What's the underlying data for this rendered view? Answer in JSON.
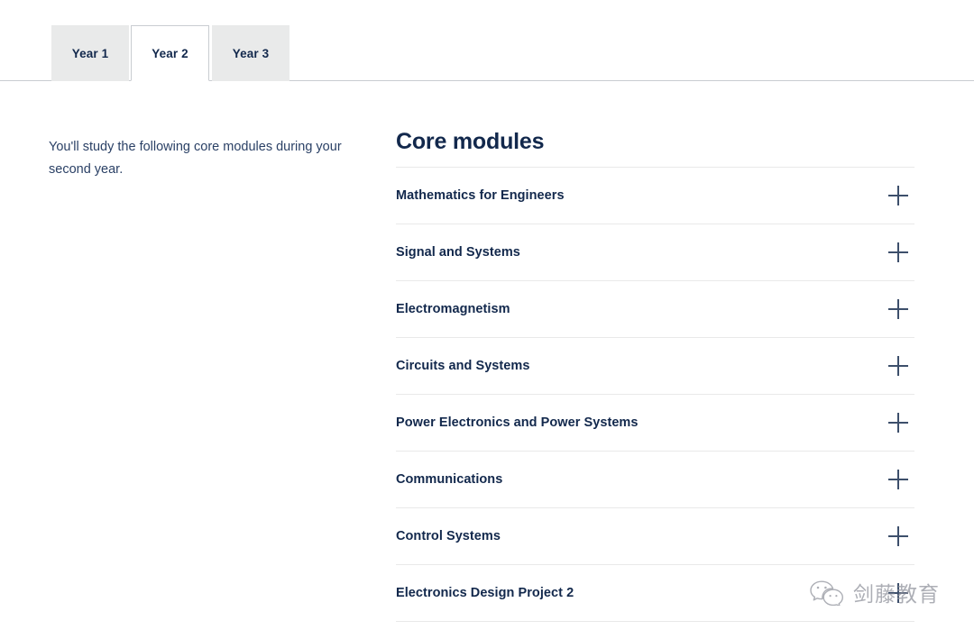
{
  "tabs": {
    "items": [
      {
        "label": "Year 1",
        "active": false
      },
      {
        "label": "Year 2",
        "active": true
      },
      {
        "label": "Year 3",
        "active": false
      }
    ]
  },
  "intro": {
    "text": "You'll study the following core modules during your second year."
  },
  "modules": {
    "heading": "Core modules",
    "expand_icon": "plus-icon",
    "items": [
      {
        "label": "Mathematics for Engineers"
      },
      {
        "label": "Signal and Systems"
      },
      {
        "label": "Electromagnetism"
      },
      {
        "label": "Circuits and Systems"
      },
      {
        "label": "Power Electronics and Power Systems"
      },
      {
        "label": "Communications"
      },
      {
        "label": "Control Systems"
      },
      {
        "label": "Electronics Design Project 2"
      }
    ]
  },
  "watermark": {
    "icon": "wechat-icon",
    "text": "剑藤教育"
  },
  "colors": {
    "navy": "#12284c",
    "body_text": "#2b4166",
    "tab_inactive_bg": "#e9eaea",
    "divider": "#e9e9e9",
    "tab_border": "#c9ccd1",
    "icon": "#3d4f6b"
  }
}
